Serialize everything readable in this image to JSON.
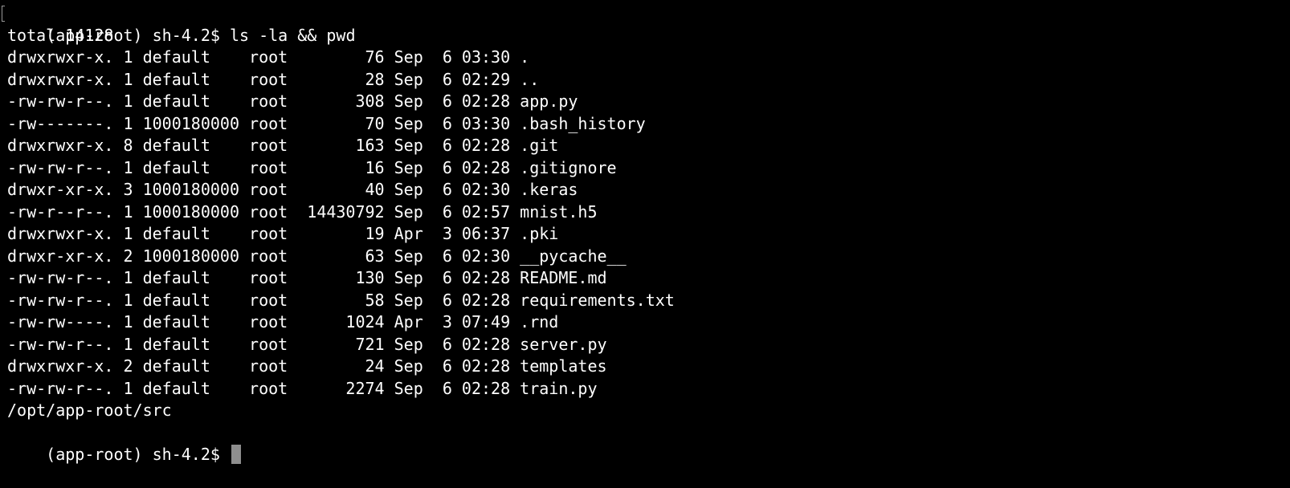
{
  "terminal": {
    "command_line": "(app-root) sh-4.2$ ls -la && pwd",
    "total_line": "total 14128",
    "listing": [
      "drwxrwxr-x. 1 default    root        76 Sep  6 03:30 .",
      "drwxrwxr-x. 1 default    root        28 Sep  6 02:29 ..",
      "-rw-rw-r--. 1 default    root       308 Sep  6 02:28 app.py",
      "-rw-------. 1 1000180000 root        70 Sep  6 03:30 .bash_history",
      "drwxrwxr-x. 8 default    root       163 Sep  6 02:28 .git",
      "-rw-rw-r--. 1 default    root        16 Sep  6 02:28 .gitignore",
      "drwxr-xr-x. 3 1000180000 root        40 Sep  6 02:30 .keras",
      "-rw-r--r--. 1 1000180000 root  14430792 Sep  6 02:57 mnist.h5",
      "drwxrwxr-x. 1 default    root        19 Apr  3 06:37 .pki",
      "drwxr-xr-x. 2 1000180000 root        63 Sep  6 02:30 __pycache__",
      "-rw-rw-r--. 1 default    root       130 Sep  6 02:28 README.md",
      "-rw-rw-r--. 1 default    root        58 Sep  6 02:28 requirements.txt",
      "-rw-rw----. 1 default    root      1024 Apr  3 07:49 .rnd",
      "-rw-rw-r--. 1 default    root       721 Sep  6 02:28 server.py",
      "drwxrwxr-x. 2 default    root        24 Sep  6 02:28 templates",
      "-rw-rw-r--. 1 default    root      2274 Sep  6 02:28 train.py"
    ],
    "pwd_output": "/opt/app-root/src",
    "current_prompt": "(app-root) sh-4.2$ ",
    "colors": {
      "background": "#000000",
      "foreground": "#ffffff",
      "cursor": "#8e8e8e"
    },
    "cursor_icon": "block-cursor"
  }
}
